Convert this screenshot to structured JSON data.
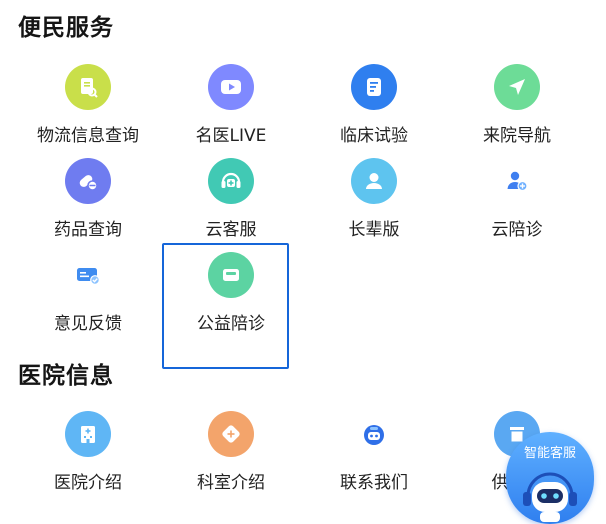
{
  "sections": [
    {
      "title": "便民服务",
      "items": [
        {
          "label": "物流信息查询",
          "icon": "logistics-icon",
          "color": "#c9df4a"
        },
        {
          "label": "名医LIVE",
          "icon": "live-play-icon",
          "color": "#7f89ff"
        },
        {
          "label": "临床试验",
          "icon": "clinical-trial-icon",
          "color": "#2f7fef"
        },
        {
          "label": "来院导航",
          "icon": "navigation-icon",
          "color": "#6ddc97"
        },
        {
          "label": "药品查询",
          "icon": "medicine-icon",
          "color": "#6f7cf0"
        },
        {
          "label": "云客服",
          "icon": "cloud-service-icon",
          "color": "#41c9b4"
        },
        {
          "label": "长辈版",
          "icon": "elder-mode-icon",
          "color": "#5ec4ef"
        },
        {
          "label": "云陪诊",
          "icon": "cloud-escort-icon",
          "color": "#3f7ff0"
        },
        {
          "label": "意见反馈",
          "icon": "feedback-icon",
          "color": "#3f8cf0"
        },
        {
          "label": "公益陪诊",
          "icon": "charity-escort-icon",
          "color": "#5cd3a2"
        }
      ]
    },
    {
      "title": "医院信息",
      "items": [
        {
          "label": "医院介绍",
          "icon": "hospital-icon",
          "color": "#5fb6f5"
        },
        {
          "label": "科室介绍",
          "icon": "department-icon",
          "color": "#f3a46b"
        },
        {
          "label": "联系我们",
          "icon": "contact-robot-icon",
          "color": "#2f6fe8"
        },
        {
          "label": "供应商",
          "icon": "supplier-icon",
          "color": "#5aa8f2"
        }
      ]
    }
  ],
  "assistant": {
    "label": "智能客服",
    "icon": "robot-assistant-icon"
  }
}
